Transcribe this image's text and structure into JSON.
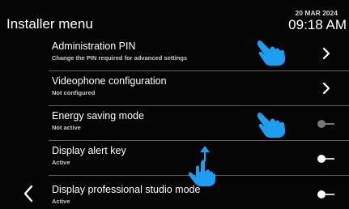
{
  "header": {
    "title": "Installer menu",
    "date": "20 MAR 2024",
    "time": "09:18 AM"
  },
  "menu": {
    "items": [
      {
        "label": "Administration PIN",
        "sub": "Change the PIN required for advanced settings",
        "control": "chevron"
      },
      {
        "label": "Videophone configuration",
        "sub": "Not configured",
        "control": "chevron"
      },
      {
        "label": "Energy saving mode",
        "sub": "Not active",
        "control": "toggle-off"
      },
      {
        "label": "Display alert key",
        "sub": "Active",
        "control": "toggle-on"
      },
      {
        "label": "Display professional studio mode",
        "sub": "Active",
        "control": "toggle-on"
      }
    ]
  },
  "icons": {
    "back": "chevron-left-icon",
    "chevron": "chevron-right-icon",
    "gesture_tap": "hand-pointer-icon",
    "gesture_scroll": "hand-swipe-up-icon"
  },
  "colors": {
    "background": "#050505",
    "separator": "#5e5e5e",
    "gesture_hand": "#1e9ef0",
    "toggle_active": "#ffffff",
    "toggle_inactive": "#777777"
  }
}
